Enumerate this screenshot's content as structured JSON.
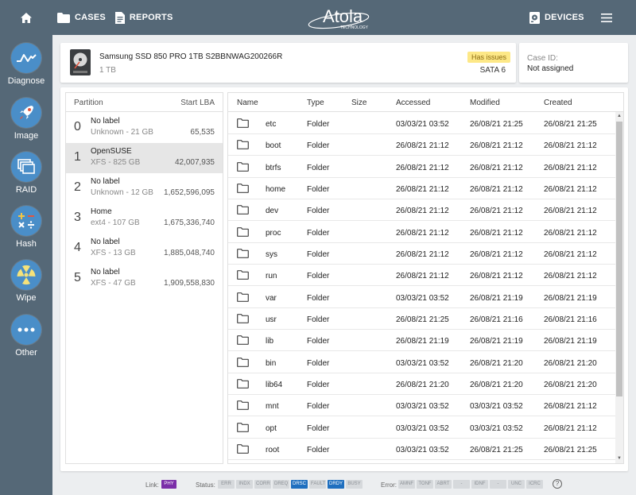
{
  "topbar": {
    "cases_label": "CASES",
    "reports_label": "REPORTS",
    "devices_label": "DEVICES",
    "logo_text": "Atola",
    "logo_subtext": "TECHNOLOGY",
    "background": "#556877"
  },
  "sidebar": {
    "items": [
      {
        "label": "Diagnose",
        "icon": "diagnose-icon"
      },
      {
        "label": "Image",
        "icon": "rocket-icon"
      },
      {
        "label": "RAID",
        "icon": "raid-icon"
      },
      {
        "label": "Hash",
        "icon": "hash-icon"
      },
      {
        "label": "Wipe",
        "icon": "wipe-icon"
      },
      {
        "label": "Other",
        "icon": "more-icon"
      }
    ]
  },
  "device": {
    "name": "Samsung SSD 850 PRO 1TB S2BBNWAG200266R",
    "size": "1 TB",
    "badge": "Has issues",
    "interface": "SATA 6",
    "badge_color": "#fde887"
  },
  "case": {
    "label": "Case ID:",
    "value": "Not assigned"
  },
  "partitions": {
    "header_partition": "Partition",
    "header_lba": "Start LBA",
    "selected_index": 1,
    "rows": [
      {
        "num": "0",
        "label": "No label",
        "fs": "Unknown - 21 GB",
        "lba": "65,535"
      },
      {
        "num": "1",
        "label": "OpenSUSE",
        "fs": "XFS - 825 GB",
        "lba": "42,007,935"
      },
      {
        "num": "2",
        "label": "No label",
        "fs": "Unknown - 12 GB",
        "lba": "1,652,596,095"
      },
      {
        "num": "3",
        "label": "Home",
        "fs": "ext4 - 107 GB",
        "lba": "1,675,336,740"
      },
      {
        "num": "4",
        "label": "No label",
        "fs": "XFS - 13 GB",
        "lba": "1,885,048,740"
      },
      {
        "num": "5",
        "label": "No label",
        "fs": "XFS - 47 GB",
        "lba": "1,909,558,830"
      }
    ]
  },
  "files": {
    "headers": {
      "name": "Name",
      "type": "Type",
      "size": "Size",
      "accessed": "Accessed",
      "modified": "Modified",
      "created": "Created"
    },
    "rows": [
      {
        "name": "etc",
        "type": "Folder",
        "size": "",
        "accessed": "03/03/21 03:52",
        "modified": "26/08/21 21:25",
        "created": "26/08/21 21:25"
      },
      {
        "name": "boot",
        "type": "Folder",
        "size": "",
        "accessed": "26/08/21 21:12",
        "modified": "26/08/21 21:12",
        "created": "26/08/21 21:12"
      },
      {
        "name": "btrfs",
        "type": "Folder",
        "size": "",
        "accessed": "26/08/21 21:12",
        "modified": "26/08/21 21:12",
        "created": "26/08/21 21:12"
      },
      {
        "name": "home",
        "type": "Folder",
        "size": "",
        "accessed": "26/08/21 21:12",
        "modified": "26/08/21 21:12",
        "created": "26/08/21 21:12"
      },
      {
        "name": "dev",
        "type": "Folder",
        "size": "",
        "accessed": "26/08/21 21:12",
        "modified": "26/08/21 21:12",
        "created": "26/08/21 21:12"
      },
      {
        "name": "proc",
        "type": "Folder",
        "size": "",
        "accessed": "26/08/21 21:12",
        "modified": "26/08/21 21:12",
        "created": "26/08/21 21:12"
      },
      {
        "name": "sys",
        "type": "Folder",
        "size": "",
        "accessed": "26/08/21 21:12",
        "modified": "26/08/21 21:12",
        "created": "26/08/21 21:12"
      },
      {
        "name": "run",
        "type": "Folder",
        "size": "",
        "accessed": "26/08/21 21:12",
        "modified": "26/08/21 21:12",
        "created": "26/08/21 21:12"
      },
      {
        "name": "var",
        "type": "Folder",
        "size": "",
        "accessed": "03/03/21 03:52",
        "modified": "26/08/21 21:19",
        "created": "26/08/21 21:19"
      },
      {
        "name": "usr",
        "type": "Folder",
        "size": "",
        "accessed": "26/08/21 21:25",
        "modified": "26/08/21 21:16",
        "created": "26/08/21 21:16"
      },
      {
        "name": "lib",
        "type": "Folder",
        "size": "",
        "accessed": "26/08/21 21:19",
        "modified": "26/08/21 21:19",
        "created": "26/08/21 21:19"
      },
      {
        "name": "bin",
        "type": "Folder",
        "size": "",
        "accessed": "03/03/21 03:52",
        "modified": "26/08/21 21:20",
        "created": "26/08/21 21:20"
      },
      {
        "name": "lib64",
        "type": "Folder",
        "size": "",
        "accessed": "26/08/21 21:20",
        "modified": "26/08/21 21:20",
        "created": "26/08/21 21:20"
      },
      {
        "name": "mnt",
        "type": "Folder",
        "size": "",
        "accessed": "03/03/21 03:52",
        "modified": "03/03/21 03:52",
        "created": "26/08/21 21:12"
      },
      {
        "name": "opt",
        "type": "Folder",
        "size": "",
        "accessed": "03/03/21 03:52",
        "modified": "03/03/21 03:52",
        "created": "26/08/21 21:12"
      },
      {
        "name": "root",
        "type": "Folder",
        "size": "",
        "accessed": "03/03/21 03:52",
        "modified": "26/08/21 21:25",
        "created": "26/08/21 21:25"
      }
    ]
  },
  "statusbar": {
    "link_label": "Link:",
    "link_chip": "PHY",
    "status_label": "Status:",
    "status_chips": [
      {
        "text": "ERR",
        "on": false
      },
      {
        "text": "INDX",
        "on": false
      },
      {
        "text": "CORR",
        "on": false
      },
      {
        "text": "DREQ",
        "on": false
      },
      {
        "text": "DRSC",
        "on": true
      },
      {
        "text": "FAULT",
        "on": false
      },
      {
        "text": "DRDY",
        "on": true
      },
      {
        "text": "BUSY",
        "on": false
      }
    ],
    "error_label": "Error:",
    "error_chips": [
      "AMNF",
      "TONF",
      "ABRT",
      "-",
      "IDNF",
      "-",
      "UNC",
      "ICRC"
    ],
    "help": "?"
  }
}
